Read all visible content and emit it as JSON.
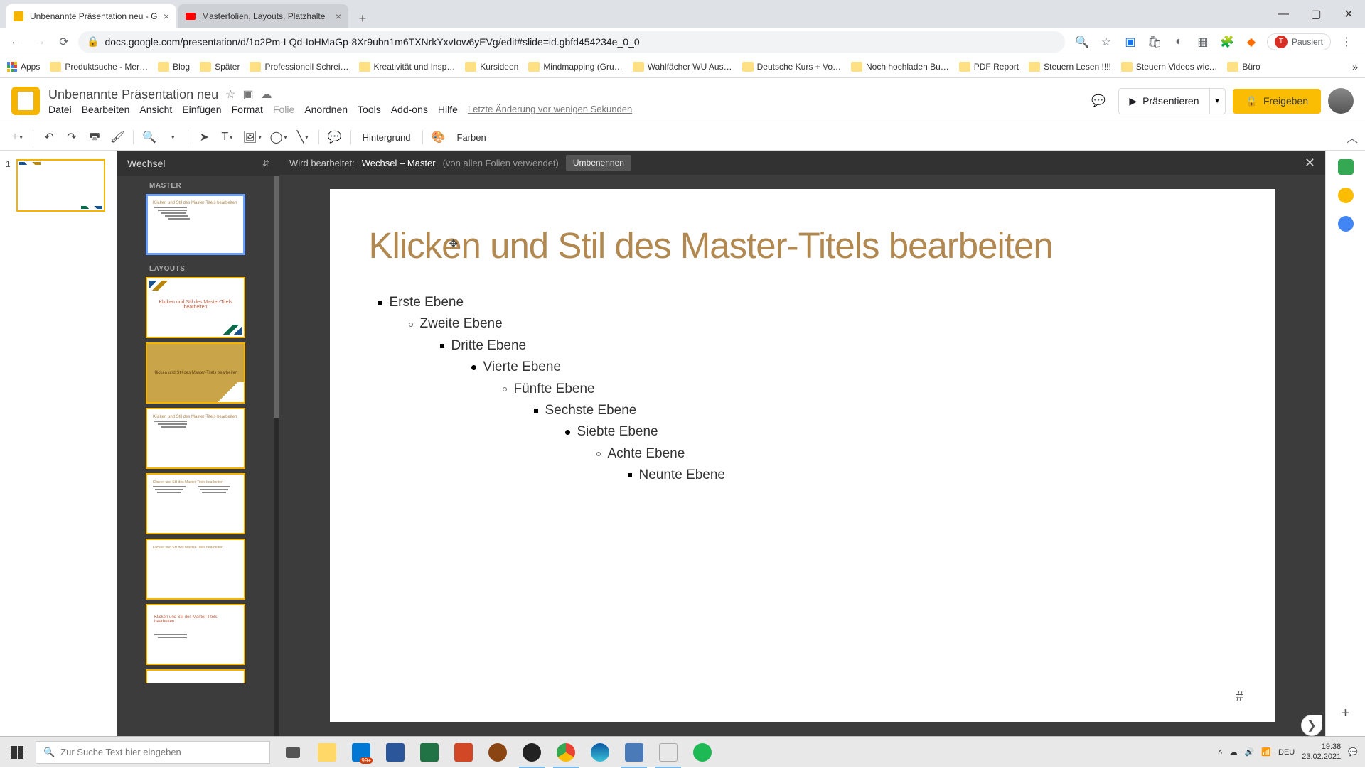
{
  "browser": {
    "tabs": [
      {
        "title": "Unbenannte Präsentation neu - G",
        "favicon_color": "#f4b400"
      },
      {
        "title": "Masterfolien, Layouts, Platzhalte",
        "favicon_color": "#ff0000"
      }
    ],
    "url": "docs.google.com/presentation/d/1o2Pm-LQd-IoHMaGp-8Xr9ubn1m6TXNrkYxvIow6yEVg/edit#slide=id.gbfd454234e_0_0",
    "paused_label": "Pausiert",
    "paused_initial": "T"
  },
  "bookmarks": {
    "apps": "Apps",
    "items": [
      "Produktsuche - Mer…",
      "Blog",
      "Später",
      "Professionell Schrei…",
      "Kreativität und Insp…",
      "Kursideen",
      "Mindmapping  (Gru…",
      "Wahlfächer WU Aus…",
      "Deutsche Kurs + Vo…",
      "Noch hochladen Bu…",
      "PDF Report",
      "Steuern Lesen !!!!",
      "Steuern Videos wic…",
      "Büro"
    ]
  },
  "app": {
    "doc_title": "Unbenannte Präsentation neu",
    "menus": [
      "Datei",
      "Bearbeiten",
      "Ansicht",
      "Einfügen",
      "Format",
      "Folie",
      "Anordnen",
      "Tools",
      "Add-ons",
      "Hilfe"
    ],
    "last_edit": "Letzte Änderung vor wenigen Sekunden",
    "present_label": "Präsentieren",
    "share_label": "Freigeben"
  },
  "toolbar": {
    "hintergrund": "Hintergrund",
    "farben": "Farben"
  },
  "master_panel": {
    "theme_name": "Wechsel",
    "section_master": "MASTER",
    "section_layouts": "LAYOUTS",
    "thumb_text": "Klicken und Stil des Master-Titels bearbeiten"
  },
  "canvas_header": {
    "prefix": "Wird bearbeitet:",
    "name": "Wechsel – Master",
    "usage": "(von allen Folien verwendet)",
    "rename": "Umbenennen"
  },
  "master_slide": {
    "title": "Klicken und Stil des Master-Titels bearbeiten",
    "levels": [
      "Erste Ebene",
      "Zweite Ebene",
      "Dritte Ebene",
      "Vierte Ebene",
      "Fünfte Ebene",
      "Sechste Ebene",
      "Siebte Ebene",
      "Achte Ebene",
      "Neunte Ebene"
    ],
    "page_number": "#"
  },
  "taskbar": {
    "search_placeholder": "Zur Suche Text hier eingeben",
    "lang": "DEU",
    "time": "19:38",
    "date": "23.02.2021",
    "mail_badge": "99+"
  }
}
